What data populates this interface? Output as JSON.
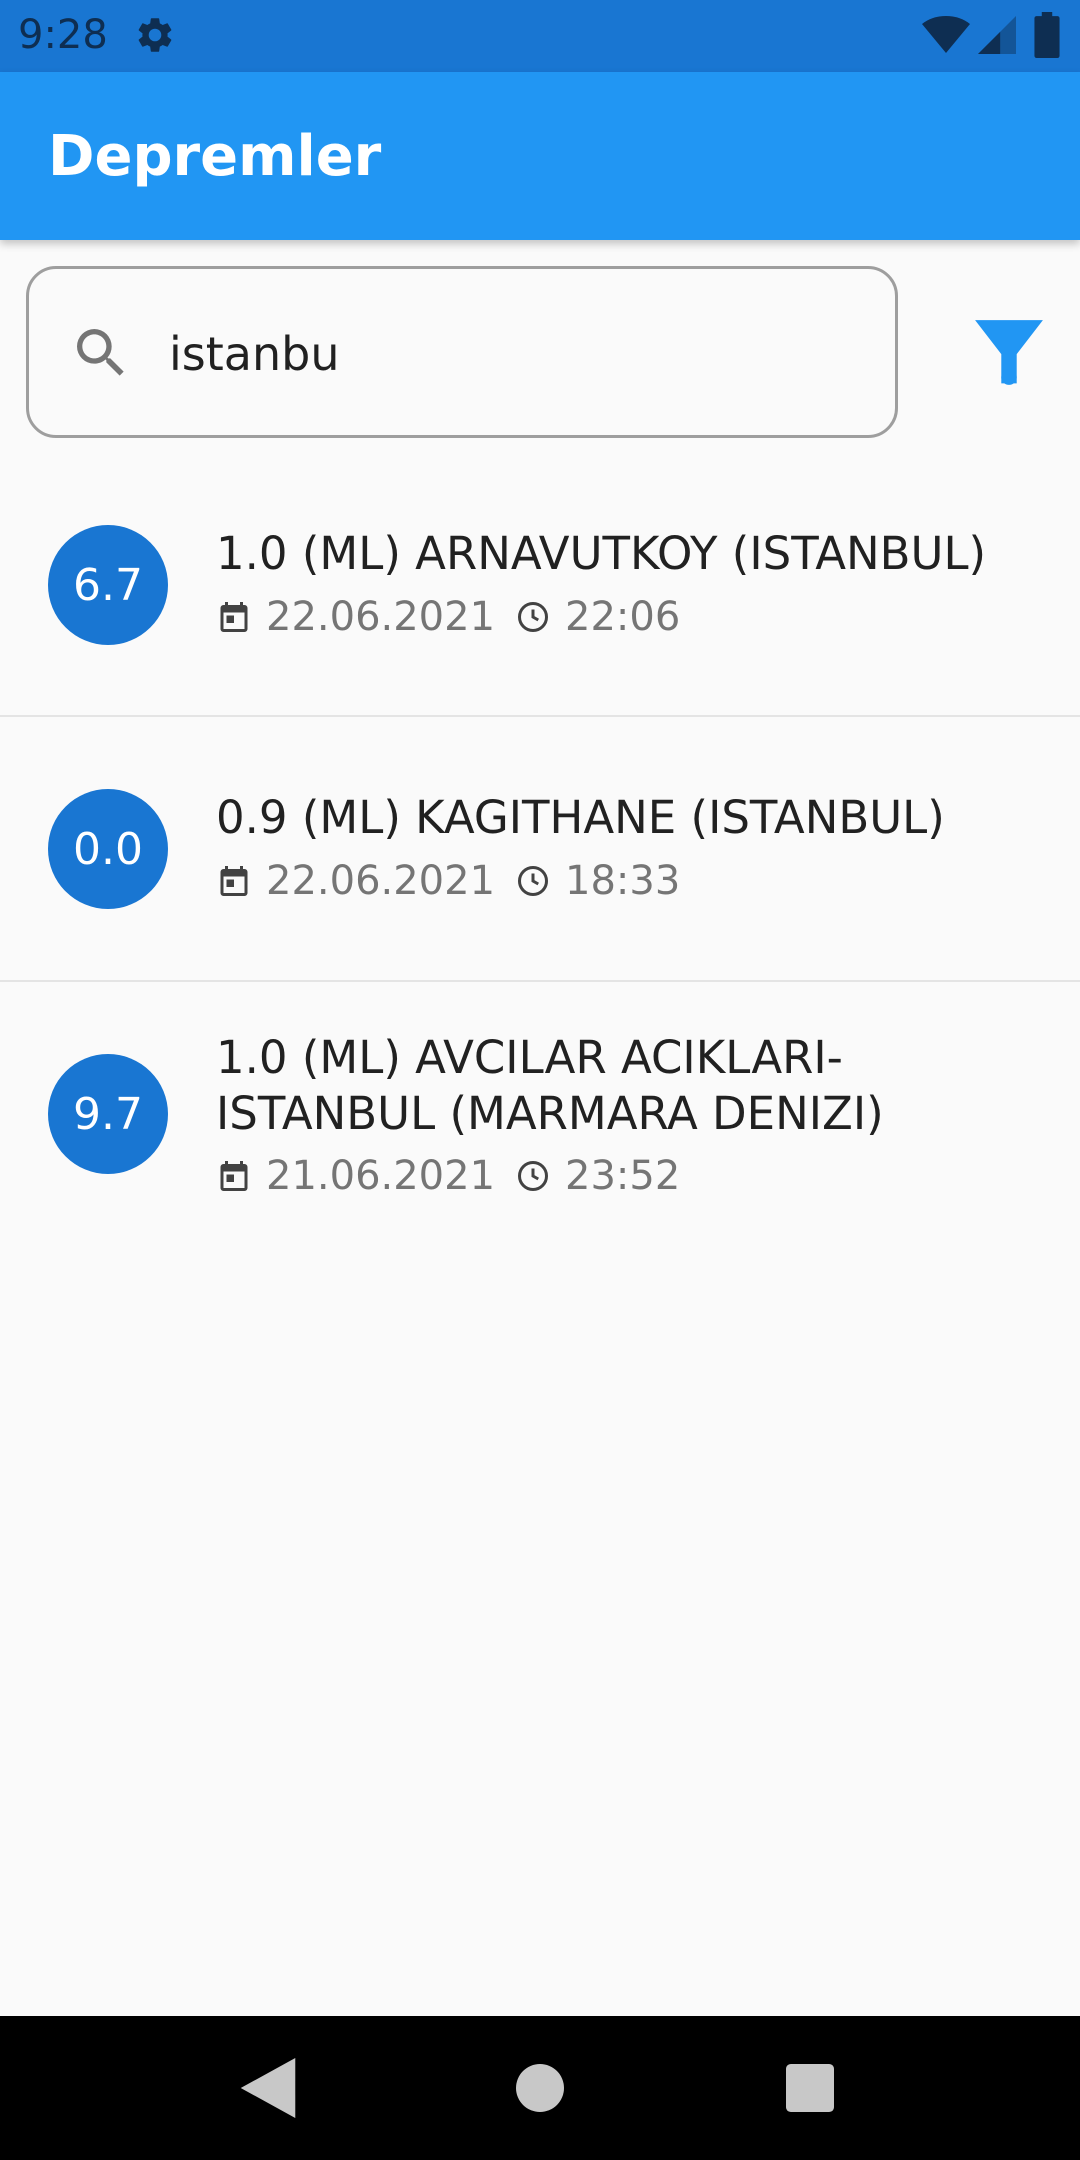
{
  "status_bar": {
    "time": "9:28",
    "icons": [
      "gear-icon",
      "wifi-icon",
      "cell-signal-icon",
      "battery-icon"
    ]
  },
  "app_bar": {
    "title": "Depremler"
  },
  "search": {
    "value": "istanbu",
    "icon": "search-icon"
  },
  "filter": {
    "icon": "filter-icon"
  },
  "colors": {
    "status_bar": "#1976d2",
    "app_bar": "#2196f3",
    "avatar": "#1976d2",
    "filter": "#2196f3",
    "background": "#fafafa"
  },
  "earthquakes": [
    {
      "magnitude": "6.7",
      "title": "1.0 (ML) ARNAVUTKOY (ISTANBUL)",
      "date": "22.06.2021",
      "time": "22:06"
    },
    {
      "magnitude": "0.0",
      "title": "0.9 (ML) KAGITHANE (ISTANBUL)",
      "date": "22.06.2021",
      "time": "18:33"
    },
    {
      "magnitude": "9.7",
      "title": "1.0 (ML) AVCILAR ACIKLARI-ISTANBUL (MARMARA DENIZI)",
      "date": "21.06.2021",
      "time": "23:52"
    }
  ],
  "nav_bar": {
    "icons": [
      "back-icon",
      "home-icon",
      "recents-icon"
    ]
  }
}
